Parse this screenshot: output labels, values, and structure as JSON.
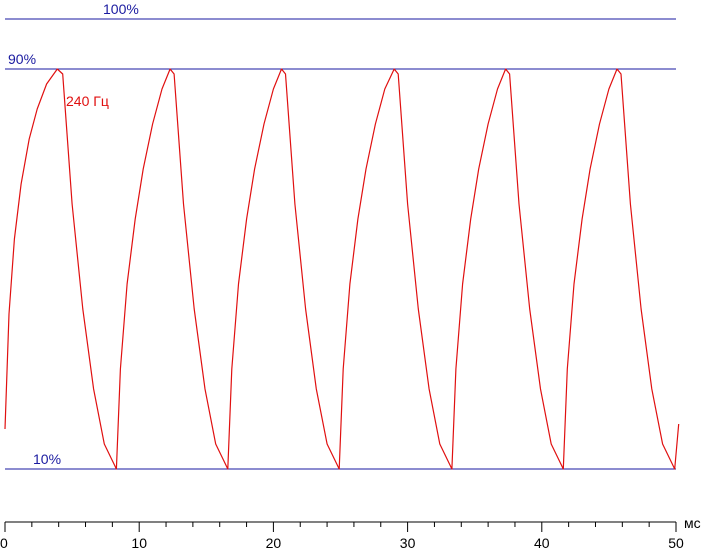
{
  "chart_data": {
    "type": "line",
    "x_unit_label": "мс",
    "xlim": [
      0,
      50
    ],
    "ylim": [
      0,
      100
    ],
    "x_ticks": [
      0,
      10,
      20,
      30,
      40,
      50
    ],
    "x_tick_labels": [
      "0",
      "10",
      "20",
      "30",
      "40",
      "50"
    ],
    "reference_lines": [
      {
        "value": 100,
        "label": "100%"
      },
      {
        "value": 90,
        "label": "90%"
      },
      {
        "value": 10,
        "label": "10%"
      }
    ],
    "series": [
      {
        "name": "240 Гц",
        "color": "#e01010",
        "points": [
          [
            0.0,
            18
          ],
          [
            0.3,
            41
          ],
          [
            0.7,
            56
          ],
          [
            1.2,
            67
          ],
          [
            1.8,
            76
          ],
          [
            2.4,
            82
          ],
          [
            3.1,
            87
          ],
          [
            3.9,
            90
          ],
          [
            4.3,
            89
          ],
          [
            5.0,
            63
          ],
          [
            5.8,
            42
          ],
          [
            6.6,
            26
          ],
          [
            7.4,
            15
          ],
          [
            8.3,
            10
          ],
          [
            8.6,
            30
          ],
          [
            9.1,
            47
          ],
          [
            9.7,
            60
          ],
          [
            10.3,
            70
          ],
          [
            11.0,
            79
          ],
          [
            11.7,
            86
          ],
          [
            12.3,
            90
          ],
          [
            12.6,
            89
          ],
          [
            13.3,
            63
          ],
          [
            14.1,
            42
          ],
          [
            14.9,
            26
          ],
          [
            15.7,
            15
          ],
          [
            16.6,
            10
          ],
          [
            16.9,
            30
          ],
          [
            17.4,
            47
          ],
          [
            18.0,
            60
          ],
          [
            18.6,
            70
          ],
          [
            19.3,
            79
          ],
          [
            20.0,
            86
          ],
          [
            20.6,
            90
          ],
          [
            20.9,
            89
          ],
          [
            21.6,
            63
          ],
          [
            22.4,
            42
          ],
          [
            23.2,
            26
          ],
          [
            24.0,
            15
          ],
          [
            24.9,
            10
          ],
          [
            25.2,
            30
          ],
          [
            25.7,
            47
          ],
          [
            26.3,
            60
          ],
          [
            26.9,
            70
          ],
          [
            27.6,
            79
          ],
          [
            28.3,
            86
          ],
          [
            29.0,
            90
          ],
          [
            29.3,
            89
          ],
          [
            30.0,
            63
          ],
          [
            30.8,
            42
          ],
          [
            31.6,
            26
          ],
          [
            32.4,
            15
          ],
          [
            33.3,
            10
          ],
          [
            33.6,
            30
          ],
          [
            34.1,
            47
          ],
          [
            34.7,
            60
          ],
          [
            35.3,
            70
          ],
          [
            36.0,
            79
          ],
          [
            36.7,
            86
          ],
          [
            37.3,
            90
          ],
          [
            37.6,
            89
          ],
          [
            38.3,
            63
          ],
          [
            39.1,
            42
          ],
          [
            39.9,
            26
          ],
          [
            40.7,
            15
          ],
          [
            41.6,
            10
          ],
          [
            41.9,
            30
          ],
          [
            42.4,
            47
          ],
          [
            43.0,
            60
          ],
          [
            43.6,
            70
          ],
          [
            44.3,
            79
          ],
          [
            45.0,
            86
          ],
          [
            45.6,
            90
          ],
          [
            45.9,
            89
          ],
          [
            46.6,
            63
          ],
          [
            47.4,
            42
          ],
          [
            48.2,
            26
          ],
          [
            49.0,
            15
          ],
          [
            49.9,
            10
          ],
          [
            50.2,
            19
          ]
        ]
      }
    ]
  }
}
